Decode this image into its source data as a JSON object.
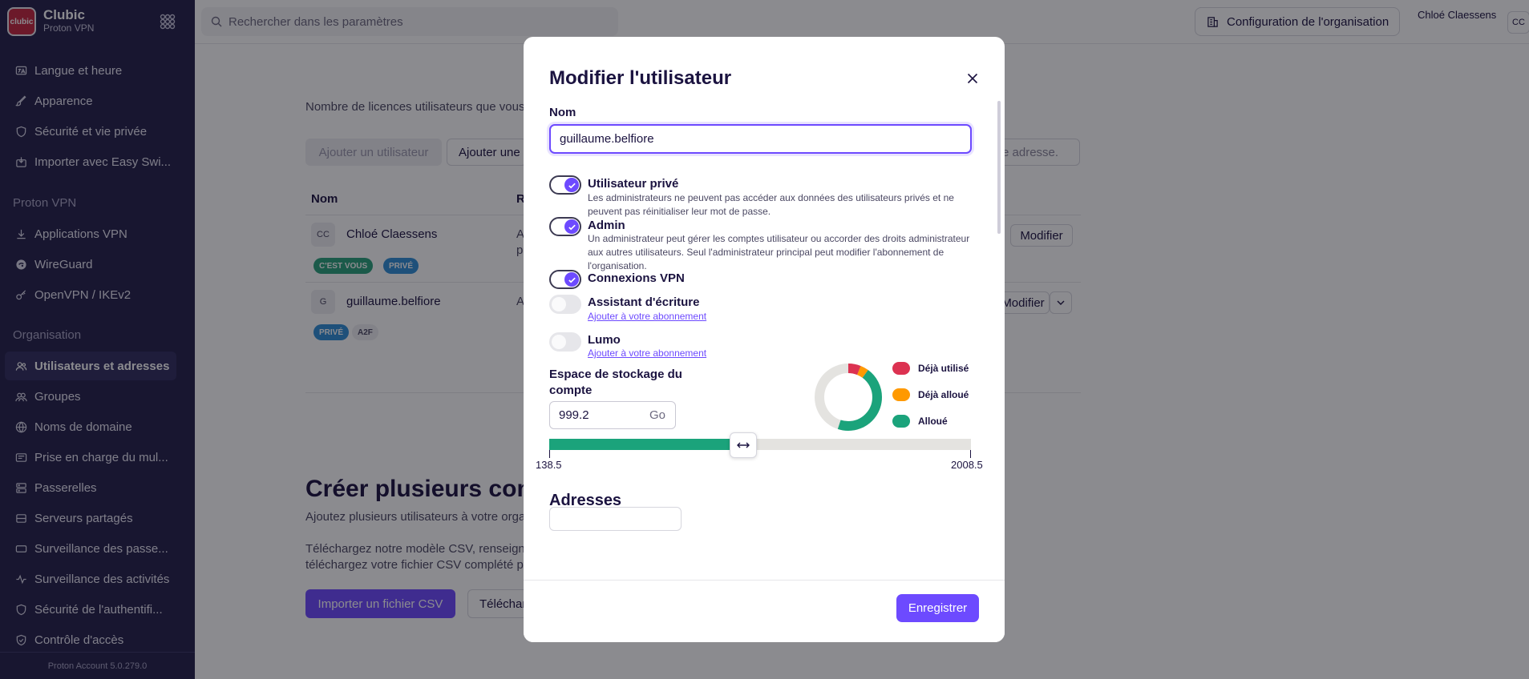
{
  "brand": {
    "name": "Clubic",
    "product": "Proton VPN",
    "logo_text": "clubic"
  },
  "sidebar": {
    "group1": [
      {
        "label": "Langue et heure",
        "icon": "language-icon"
      },
      {
        "label": "Apparence",
        "icon": "paint-brush-icon"
      },
      {
        "label": "Sécurité et vie privée",
        "icon": "shield-icon"
      },
      {
        "label": "Importer avec Easy Swi...",
        "icon": "import-icon"
      }
    ],
    "section_vpn": "Proton VPN",
    "group2": [
      {
        "label": "Applications VPN",
        "icon": "download-icon"
      },
      {
        "label": "WireGuard",
        "icon": "wireguard-icon"
      },
      {
        "label": "OpenVPN / IKEv2",
        "icon": "key-icon"
      }
    ],
    "section_org": "Organisation",
    "group3": [
      {
        "label": "Utilisateurs et adresses",
        "icon": "users-icon",
        "active": true
      },
      {
        "label": "Groupes",
        "icon": "groups-icon"
      },
      {
        "label": "Noms de domaine",
        "icon": "globe-icon"
      },
      {
        "label": "Prise en charge du mul...",
        "icon": "multi-user-icon"
      },
      {
        "label": "Passerelles",
        "icon": "server-icon"
      },
      {
        "label": "Serveurs partagés",
        "icon": "shared-servers-icon"
      },
      {
        "label": "Surveillance des passe...",
        "icon": "password-monitor-icon"
      },
      {
        "label": "Surveillance des activités",
        "icon": "activity-icon"
      },
      {
        "label": "Sécurité de l'authentifi...",
        "icon": "shield-lock-icon"
      },
      {
        "label": "Contrôle d'accès",
        "icon": "access-control-icon"
      }
    ],
    "footer": "Proton Account 5.0.279.0"
  },
  "topbar": {
    "search_placeholder": "Rechercher dans les paramètres",
    "org_button": "Configuration de l'organisation",
    "user_name": "Chloé Claessens",
    "user_initials": "CC"
  },
  "page": {
    "license_text": "Nombre de licences utilisateurs que vous",
    "add_user": "Ajouter un utilisateur",
    "add_address": "Ajouter une",
    "search_address": "e adresse.",
    "col_name": "Nom",
    "col_r": "R",
    "users": [
      {
        "initials": "CC",
        "name": "Chloé Claessens",
        "cell": "A",
        "cell2": "p",
        "badges": [
          "C'EST VOUS",
          "PRIVÉ"
        ],
        "action": "Modifier"
      },
      {
        "initials": "G",
        "name": "guillaume.belfiore",
        "cell": "A",
        "badges": [
          "PRIVÉ",
          "A2F"
        ],
        "action": "Modifier"
      }
    ],
    "bulk_title": "Créer plusieurs comp",
    "bulk_p1": "Ajoutez plusieurs utilisateurs à votre orga",
    "bulk_p2": "Téléchargez notre modèle CSV, renseigne",
    "bulk_p3": "téléchargez votre fichier CSV complété p",
    "import_csv": "Importer un fichier CSV",
    "download_btn": "Téléchar"
  },
  "modal": {
    "title": "Modifier l'utilisateur",
    "name_label": "Nom",
    "name_value": "guillaume.belfiore",
    "options": [
      {
        "title": "Utilisateur privé",
        "on": true,
        "desc": "Les administrateurs ne peuvent pas accéder aux données des utilisateurs privés et ne peuvent pas réinitialiser leur mot de passe."
      },
      {
        "title": "Admin",
        "on": true,
        "desc": "Un administrateur peut gérer les comptes utilisateur ou accorder des droits administrateur aux autres utilisateurs. Seul l'administrateur principal peut modifier l'abonnement de l'organisation."
      },
      {
        "title": "Connexions VPN",
        "on": true
      },
      {
        "title": "Assistant d'écriture",
        "on": false,
        "link": "Ajouter à votre abonnement"
      },
      {
        "title": "Lumo",
        "on": false,
        "link": "Ajouter à votre abonnement"
      }
    ],
    "storage_label": "Espace de stockage du compte",
    "storage_value": "999.2",
    "storage_unit": "Go",
    "legend": [
      {
        "label": "Déjà utilisé",
        "color": "#dc3251"
      },
      {
        "label": "Déjà alloué",
        "color": "#ff9900"
      },
      {
        "label": "Alloué",
        "color": "#1ba37b"
      }
    ],
    "donut": {
      "used": 0.06,
      "already_allocated": 0.04,
      "allocated": 0.45
    },
    "slider": {
      "min": "138.5",
      "max": "2008.5",
      "value": 999.2,
      "min_value": 138.5,
      "max_value": 2008.5
    },
    "addresses_title": "Adresses",
    "save": "Enregistrer"
  },
  "colors": {
    "accent": "#6d4aff",
    "sidebar": "#232049",
    "green": "#1ba37b"
  }
}
